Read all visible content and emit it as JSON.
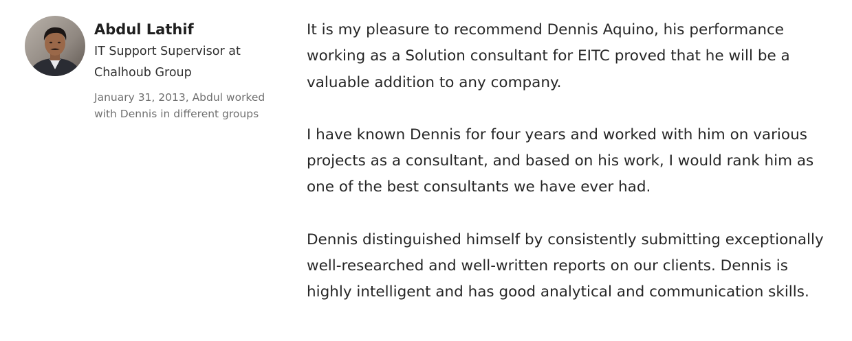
{
  "recommendation": {
    "author": {
      "name": "Abdul Lathif",
      "headline_line1": "IT Support Supervisor at",
      "headline_line2": "Chalhoub Group",
      "avatar_icon": "profile-photo",
      "meta_line1": "January 31, 2013, Abdul worked",
      "meta_line2": "with Dennis in different groups"
    },
    "paragraphs": [
      "It is my pleasure to recommend Dennis Aquino, his performance working as a Solution consultant for EITC proved that he will be a valuable addition to any company.",
      "I have known Dennis for four years and worked with him on various projects as a consultant, and based on his work, I would rank him as one of the best consultants we have ever had.",
      "Dennis distinguished himself by consistently submitting exceptionally well-researched and well-written reports on our clients. Dennis is highly intelligent and has good analytical and communication skills."
    ]
  },
  "colors": {
    "text": "#262626",
    "name": "#1f1f1f",
    "meta": "#707070",
    "background": "#ffffff"
  }
}
